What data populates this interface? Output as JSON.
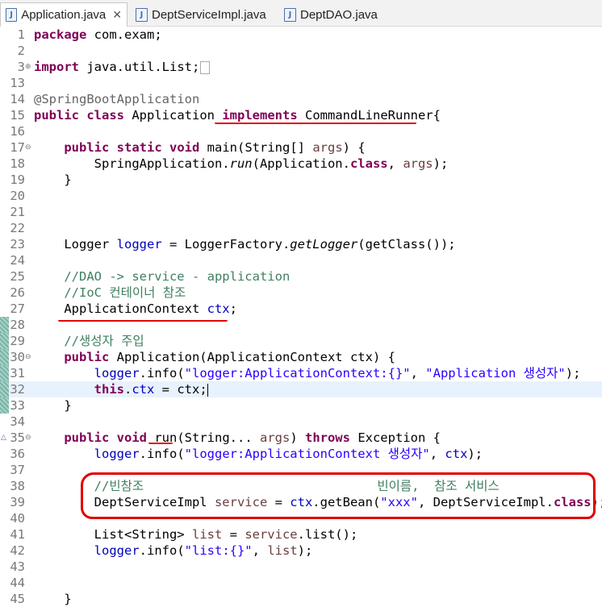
{
  "tabs": [
    {
      "label": "Application.java",
      "active": true,
      "close": "✕"
    },
    {
      "label": "DeptServiceImpl.java",
      "active": false
    },
    {
      "label": "DeptDAO.java",
      "active": false
    }
  ],
  "lines": {
    "l1": "1",
    "l2": "2",
    "l3": "3",
    "l13": "13",
    "l14": "14",
    "l15": "15",
    "l16": "16",
    "l17": "17",
    "l18": "18",
    "l19": "19",
    "l20": "20",
    "l21": "21",
    "l22": "22",
    "l23": "23",
    "l24": "24",
    "l25": "25",
    "l26": "26",
    "l27": "27",
    "l28": "28",
    "l29": "29",
    "l30": "30",
    "l31": "31",
    "l32": "32",
    "l33": "33",
    "l34": "34",
    "l35": "35",
    "l36": "36",
    "l37": "37",
    "l38": "38",
    "l39": "39",
    "l40": "40",
    "l41": "41",
    "l42": "42",
    "l43": "43",
    "l44": "44",
    "l45": "45"
  },
  "code": {
    "package_kw": "package",
    "package_name": " com.exam;",
    "import_kw": "import",
    "import_name": " java.util.List;",
    "annotation": "@SpringBootApplication",
    "l15_public": "public",
    "l15_class": "class",
    "l15_name": " Application ",
    "l15_implements": "implements",
    "l15_rest": " CommandLineRunner{",
    "l17_pub": "public",
    "l17_static": "static",
    "l17_void": "void",
    "l17_main": " main(String[] ",
    "l17_args": "args",
    "l17_end": ") {",
    "l18_a": "SpringApplication.",
    "l18_run": "run",
    "l18_b": "(Application.",
    "l18_class": "class",
    "l18_c": ", ",
    "l18_args": "args",
    "l18_d": ");",
    "l19": "}",
    "l23_a": "Logger ",
    "l23_logger": "logger",
    "l23_b": " = LoggerFactory.",
    "l23_get": "getLogger",
    "l23_c": "(getClass());",
    "l25_comment": "//DAO -> service - application",
    "l26_comment": "//IoC 컨테이너 참조",
    "l27_a": "ApplicationContext ",
    "l27_ctx": "ctx",
    "l27_b": ";",
    "l29_comment": "//생성자 주입",
    "l30_pub": "public",
    "l30_rest": " Application(ApplicationContext ctx) {",
    "l31_logger": "logger",
    "l31_a": ".info(",
    "l31_s1": "\"logger:ApplicationContext:{}\"",
    "l31_b": ", ",
    "l31_s2": "\"Application 생성자\"",
    "l31_c": ");",
    "l32_this": "this",
    "l32_a": ".",
    "l32_ctx": "ctx",
    "l32_b": " = ctx;",
    "l33": "}",
    "l35_pub": "public",
    "l35_void": "void",
    "l35_a": " run(String... ",
    "l35_args": "args",
    "l35_b": ") ",
    "l35_throws": "throws",
    "l35_c": " Exception {",
    "l36_logger": "logger",
    "l36_a": ".info(",
    "l36_s": "\"logger:ApplicationContext 생성자\"",
    "l36_b": ", ",
    "l36_ctx": "ctx",
    "l36_c": ");",
    "l38_comment": "//빈참조                               빈이름,  참조 서비스",
    "l39_a": "DeptServiceImpl ",
    "l39_service": "service",
    "l39_b": " = ",
    "l39_ctx": "ctx",
    "l39_c": ".getBean(",
    "l39_s": "\"xxx\"",
    "l39_d": ", DeptServiceImpl.",
    "l39_class": "class",
    "l39_e": ");",
    "l41_a": "List<String> ",
    "l41_list": "list",
    "l41_b": " = ",
    "l41_service": "service",
    "l41_c": ".list();",
    "l42_logger": "logger",
    "l42_a": ".info(",
    "l42_s": "\"list:{}\"",
    "l42_b": ", ",
    "l42_list": "list",
    "l42_c": ");",
    "l45": "}"
  },
  "colors": {
    "keyword": "#7f0055",
    "string": "#2a00ff",
    "comment": "#3f7f5f",
    "field": "#0000c0",
    "annotation_markup": "#e00000"
  }
}
